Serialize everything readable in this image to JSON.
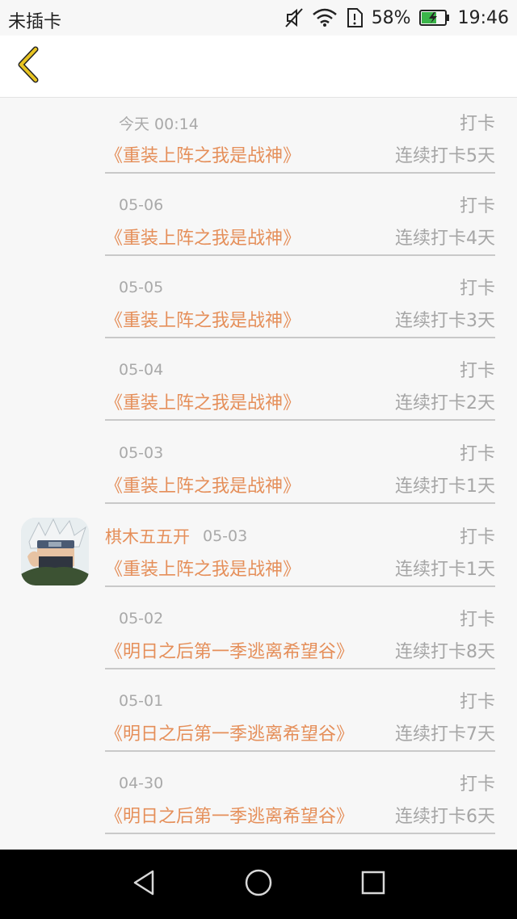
{
  "status_bar": {
    "carrier": "未插卡",
    "battery_percent": "58%",
    "time": "19:46"
  },
  "colors": {
    "accent": "#e58f5a",
    "muted": "#a6a6a6",
    "back_icon": "#e8c422"
  },
  "header": {
    "back_icon": "chevron-left-icon"
  },
  "feed": {
    "entries": [
      {
        "date": "今天 00:14",
        "action": "打卡",
        "title": "《重装上阵之我是战神》",
        "streak": "连续打卡5天"
      },
      {
        "date": "05-06",
        "action": "打卡",
        "title": "《重装上阵之我是战神》",
        "streak": "连续打卡4天"
      },
      {
        "date": "05-05",
        "action": "打卡",
        "title": "《重装上阵之我是战神》",
        "streak": "连续打卡3天"
      },
      {
        "date": "05-04",
        "action": "打卡",
        "title": "《重装上阵之我是战神》",
        "streak": "连续打卡2天"
      },
      {
        "date": "05-03",
        "action": "打卡",
        "title": "《重装上阵之我是战神》",
        "streak": "连续打卡1天"
      },
      {
        "user": "棋木五五开",
        "date": "05-03",
        "action": "打卡",
        "title": "《重装上阵之我是战神》",
        "streak": "连续打卡1天"
      },
      {
        "date": "05-02",
        "action": "打卡",
        "title": "《明日之后第一季逃离希望谷》",
        "streak": "连续打卡8天"
      },
      {
        "date": "05-01",
        "action": "打卡",
        "title": "《明日之后第一季逃离希望谷》",
        "streak": "连续打卡7天"
      },
      {
        "date": "04-30",
        "action": "打卡",
        "title": "《明日之后第一季逃离希望谷》",
        "streak": "连续打卡6天"
      }
    ]
  },
  "nav_bar": {
    "back_icon": "triangle-back-icon",
    "home_icon": "circle-home-icon",
    "recents_icon": "square-recents-icon"
  }
}
